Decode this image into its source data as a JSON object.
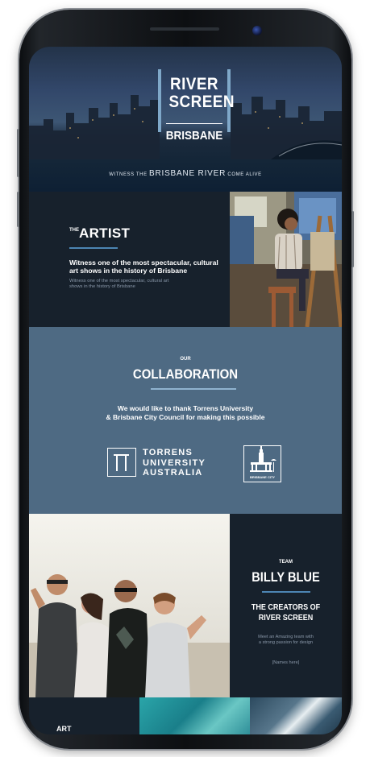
{
  "hero": {
    "title_line1": "RIVER",
    "title_line2": "SCREEN",
    "title_line3": "BRISBANE",
    "tagline_pre": "WITNESS THE",
    "tagline_highlight": "BRISBANE RIVER",
    "tagline_post": "COME ALIVE"
  },
  "artist": {
    "heading_prefix": "THE",
    "heading": "ARTIST",
    "lead": "Witness one of the most spectacular, cultural art shows in the history of Brisbane",
    "body": "Witness one of the most spectacular, cultural art shows in the history of Brisbane"
  },
  "collab": {
    "kicker": "OUR",
    "heading": "COLLABORATION",
    "text_line1": "We would like to thank Torrens University",
    "text_line2": "& Brisbane City Council for making this possible",
    "torrens_line1": "TORRENS",
    "torrens_line2": "UNIVERSITY",
    "torrens_line3": "AUSTRALIA",
    "bcc_label": "BRISBANE CITY"
  },
  "team": {
    "kicker": "TEAM",
    "heading": "BILLY BLUE",
    "sub_line1": "THE CREATORS OF",
    "sub_line2": "RIVER SCREEN",
    "body_line1": "Meet an Amazing team with",
    "body_line2": "a strong passion for design",
    "names": "[Names here]"
  },
  "bottom": {
    "label": "ART"
  },
  "colors": {
    "dark": "#17212c",
    "steel": "#4e6a83",
    "accent": "#4c85b3"
  }
}
